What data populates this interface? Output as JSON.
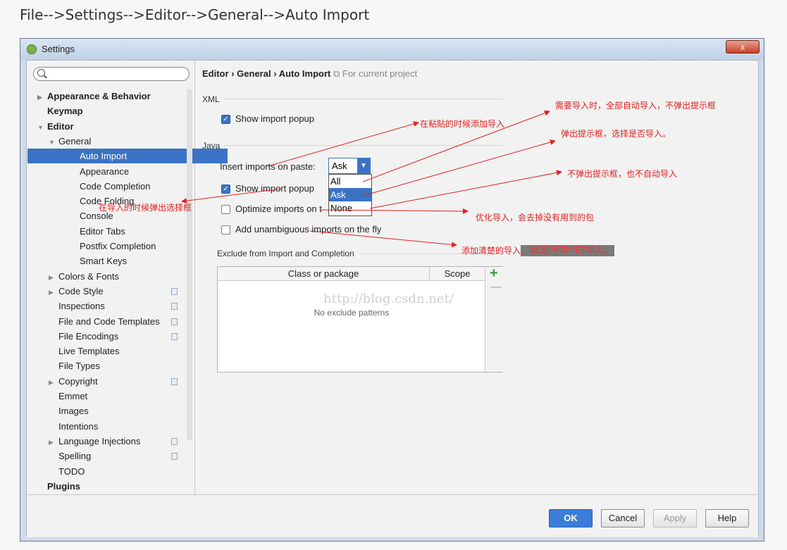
{
  "caption": "File-->Settings-->Editor-->General-->Auto Import",
  "window": {
    "title": "Settings",
    "close_label": "x"
  },
  "sidebar": {
    "search_placeholder": "",
    "items": [
      {
        "label": "Appearance & Behavior",
        "level": 0,
        "bold": true,
        "arrow": "▶"
      },
      {
        "label": "Keymap",
        "level": 0,
        "bold": true,
        "arrow": ""
      },
      {
        "label": "Editor",
        "level": 0,
        "bold": true,
        "arrow": "▼"
      },
      {
        "label": "General",
        "level": 1,
        "bold": false,
        "arrow": "▼"
      },
      {
        "label": "Auto Import",
        "level": 2,
        "bold": false,
        "arrow": "",
        "selected": true
      },
      {
        "label": "Appearance",
        "level": 2,
        "bold": false,
        "arrow": ""
      },
      {
        "label": "Code Completion",
        "level": 2,
        "bold": false,
        "arrow": ""
      },
      {
        "label": "Code Folding",
        "level": 2,
        "bold": false,
        "arrow": ""
      },
      {
        "label": "Console",
        "level": 2,
        "bold": false,
        "arrow": ""
      },
      {
        "label": "Editor Tabs",
        "level": 2,
        "bold": false,
        "arrow": ""
      },
      {
        "label": "Postfix Completion",
        "level": 2,
        "bold": false,
        "arrow": ""
      },
      {
        "label": "Smart Keys",
        "level": 2,
        "bold": false,
        "arrow": ""
      },
      {
        "label": "Colors & Fonts",
        "level": 1,
        "bold": false,
        "arrow": "▶"
      },
      {
        "label": "Code Style",
        "level": 1,
        "bold": false,
        "arrow": "▶",
        "icon": true
      },
      {
        "label": "Inspections",
        "level": 1,
        "bold": false,
        "arrow": "",
        "icon": true
      },
      {
        "label": "File and Code Templates",
        "level": 1,
        "bold": false,
        "arrow": "",
        "icon": true
      },
      {
        "label": "File Encodings",
        "level": 1,
        "bold": false,
        "arrow": "",
        "icon": true
      },
      {
        "label": "Live Templates",
        "level": 1,
        "bold": false,
        "arrow": ""
      },
      {
        "label": "File Types",
        "level": 1,
        "bold": false,
        "arrow": ""
      },
      {
        "label": "Copyright",
        "level": 1,
        "bold": false,
        "arrow": "▶",
        "icon": true
      },
      {
        "label": "Emmet",
        "level": 1,
        "bold": false,
        "arrow": ""
      },
      {
        "label": "Images",
        "level": 1,
        "bold": false,
        "arrow": ""
      },
      {
        "label": "Intentions",
        "level": 1,
        "bold": false,
        "arrow": ""
      },
      {
        "label": "Language Injections",
        "level": 1,
        "bold": false,
        "arrow": "▶",
        "icon": true
      },
      {
        "label": "Spelling",
        "level": 1,
        "bold": false,
        "arrow": "",
        "icon": true
      },
      {
        "label": "TODO",
        "level": 1,
        "bold": false,
        "arrow": ""
      },
      {
        "label": "Plugins",
        "level": 0,
        "bold": true,
        "arrow": ""
      }
    ]
  },
  "breadcrumb": {
    "p1": "Editor",
    "sep": "›",
    "p2": "General",
    "p3": "Auto Import",
    "scope": "For current project"
  },
  "xml": {
    "section": "XML",
    "show_popup": "Show import popup"
  },
  "java": {
    "section": "Java",
    "insert_label": "Insert imports on paste:",
    "insert_value": "Ask",
    "options": [
      "All",
      "Ask",
      "None"
    ],
    "show_popup": "Show import popup",
    "optimize": "Optimize imports on t",
    "unambiguous": "Add unambiguous imports on the fly"
  },
  "exclude": {
    "section": "Exclude from Import and Completion",
    "col1": "Class or package",
    "col2": "Scope",
    "empty": "No exclude patterns",
    "watermark": "http://blog.csdn.net/"
  },
  "buttons": {
    "ok": "OK",
    "cancel": "Cancel",
    "apply": "Apply",
    "help": "Help"
  },
  "annotations": {
    "a1": "需要导入时，全部自动导入，不弹出提示框",
    "a2": "在粘贴的时候添加导入",
    "a3": "弹出提示框，选择是否导入。",
    "a4": "不弹出提示框，也不自动导入",
    "a5": "在导入的时候弹出选择框",
    "a6": "优化导入，会去掉没有用到的包",
    "a7": "添加清楚的导入",
    "a8": "，就是不带*的导入。"
  },
  "colors": {
    "accent": "#3b73c4",
    "annotation": "#e02020"
  }
}
